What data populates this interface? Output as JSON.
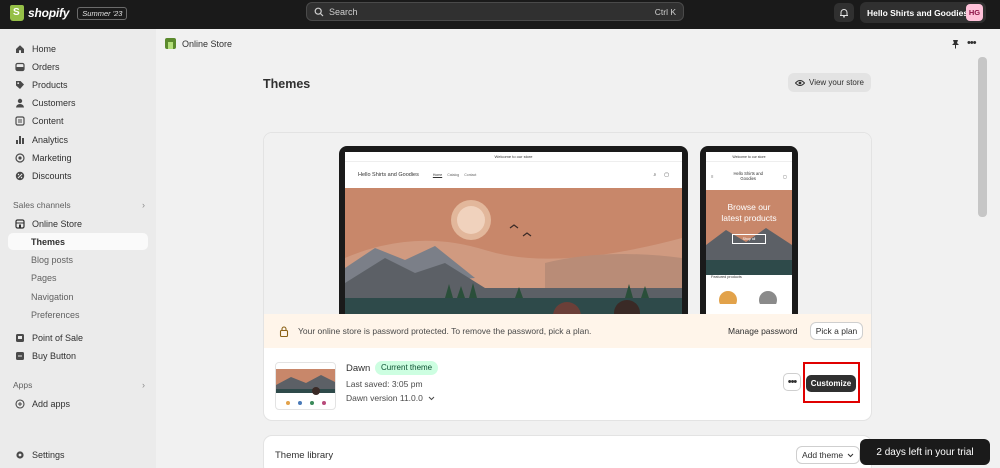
{
  "topbar": {
    "logo_text": "shopify",
    "edition_badge": "Summer '23",
    "search_placeholder": "Search",
    "search_shortcut": "Ctrl K",
    "store_name": "Hello Shirts and Goodies",
    "avatar_initials": "HG"
  },
  "sidebar": {
    "items": [
      {
        "label": "Home",
        "icon": "home-icon"
      },
      {
        "label": "Orders",
        "icon": "orders-icon"
      },
      {
        "label": "Products",
        "icon": "tag-icon"
      },
      {
        "label": "Customers",
        "icon": "person-icon"
      },
      {
        "label": "Content",
        "icon": "content-icon"
      },
      {
        "label": "Analytics",
        "icon": "bar-chart-icon"
      },
      {
        "label": "Marketing",
        "icon": "target-icon"
      },
      {
        "label": "Discounts",
        "icon": "discount-icon"
      }
    ],
    "sales_channels_label": "Sales channels",
    "online_store": "Online Store",
    "online_store_sub": [
      "Themes",
      "Blog posts",
      "Pages",
      "Navigation",
      "Preferences"
    ],
    "point_of_sale": "Point of Sale",
    "buy_button": "Buy Button",
    "apps_label": "Apps",
    "add_apps": "Add apps",
    "settings": "Settings"
  },
  "main": {
    "breadcrumb": "Online Store",
    "title": "Themes",
    "view_store_label": "View your store",
    "preview": {
      "announcement": "Welcome to our store",
      "store_title": "Hello Shirts and Goodies",
      "nav_links": [
        "Home",
        "Catalog",
        "Contact"
      ],
      "mobile_hero_line1": "Browse our",
      "mobile_hero_line2": "latest products",
      "mobile_hero_button": "Shop all",
      "mobile_featured": "Featured products"
    },
    "banner": {
      "text": "Your online store is password protected. To remove the password, pick a plan.",
      "manage_password": "Manage password",
      "pick_plan": "Pick a plan"
    },
    "theme": {
      "name": "Dawn",
      "badge": "Current theme",
      "last_saved": "Last saved: 3:05 pm",
      "version": "Dawn version 11.0.0",
      "customize_label": "Customize"
    },
    "library": {
      "title": "Theme library",
      "add_theme": "Add theme"
    }
  },
  "trial_banner": "2 days left in your trial",
  "colors": {
    "topbar_bg": "#1a1a1a",
    "sidebar_bg": "#ebebeb",
    "badge_green_bg": "#cdfee1",
    "badge_green_text": "#0c5132",
    "banner_bg": "#fff5ea",
    "highlight_red": "#e00000",
    "primary_button": "#303030"
  }
}
